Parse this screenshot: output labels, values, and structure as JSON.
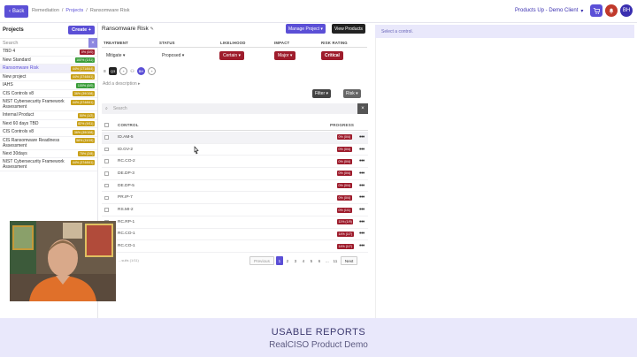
{
  "topbar": {
    "back_label": "Back",
    "crumbs": [
      "Remediation",
      "Projects",
      "Ransomware Risk"
    ],
    "client": "Products Up - Demo Client",
    "avatar": "BH"
  },
  "sidebar": {
    "title": "Projects",
    "create_label": "Create",
    "search_placeholder": "Search",
    "items": [
      {
        "name": "TBD 4",
        "badge": "0% (0/0)",
        "color": "#9e1c2c"
      },
      {
        "name": "New Standard",
        "badge": "100% (1/11)",
        "color": "#3a9d3a"
      },
      {
        "name": "Ransomware Risk",
        "badge": "44% (171/844)",
        "color": "#c9a11a"
      },
      {
        "name": "New project",
        "badge": "44% (374/841)",
        "color": "#c9a11a"
      },
      {
        "name": "IAHS",
        "badge": "100% (0/0)",
        "color": "#3a9d3a"
      },
      {
        "name": "CIS Controls v8",
        "badge": "36% (39/108)",
        "color": "#c9a11a"
      },
      {
        "name": "NIST Cybersecurity Framework Assessment",
        "badge": "44% (374/841)",
        "color": "#c9a11a"
      },
      {
        "name": "Internal Product",
        "badge": "50% (1/2)",
        "color": "#c9a11a"
      },
      {
        "name": "Next 60 days TBD",
        "badge": "82% (9/11)",
        "color": "#c9a11a"
      },
      {
        "name": "CIS Controls v8",
        "badge": "36% (39/108)",
        "color": "#c9a11a"
      },
      {
        "name": "CIS Ransomware Readiness Assessment",
        "badge": "58% (11/19)",
        "color": "#c9a11a"
      },
      {
        "name": "Next 30days",
        "badge": "75% (2/8)",
        "color": "#c9a11a"
      },
      {
        "name": "NIST Cybersecurity Framework Assessment",
        "badge": "44% (374/841)",
        "color": "#c9a11a"
      }
    ]
  },
  "risk": {
    "title": "Ransomware Risk",
    "manage_label": "Manage Project",
    "view_label": "View Products",
    "headers": {
      "treatment": "TREATMENT",
      "status": "STATUS",
      "likelihood": "LIKELIHOOD",
      "impact": "IMPACT",
      "risk_rating": "RISK RATING"
    },
    "treatment": "Mitigate",
    "status": "Proposed",
    "likelihood": "Certain",
    "impact": "Major",
    "risk_rating": "Critical",
    "tag1": "Q3",
    "tag2": "BH",
    "add_description": "Add a description"
  },
  "filters": {
    "filter_label": "Filter",
    "risk_label": "Risk"
  },
  "search": {
    "placeholder": "Search"
  },
  "table": {
    "col_control": "CONTROL",
    "col_progress": "PROGRESS",
    "rows": [
      {
        "control": "ID.AM-5",
        "progress": "0% (0/4)",
        "color": "#9e1c2c"
      },
      {
        "control": "ID.GV-2",
        "progress": "0% (0/4)",
        "color": "#9e1c2c"
      },
      {
        "control": "RC.CO-2",
        "progress": "0% (0/4)",
        "color": "#9e1c2c"
      },
      {
        "control": "DE.DP-3",
        "progress": "0% (0/4)",
        "color": "#9e1c2c"
      },
      {
        "control": "DE.DP-5",
        "progress": "0% (0/4)",
        "color": "#9e1c2c"
      },
      {
        "control": "PR.IP-7",
        "progress": "0% (0/4)",
        "color": "#9e1c2c"
      },
      {
        "control": "RS.MI-2",
        "progress": "0% (1/1)",
        "color": "#9e1c2c"
      },
      {
        "control": "RC.RP-1",
        "progress": "11% (1/9)",
        "color": "#9e1c2c"
      },
      {
        "control": "RC.CO-1",
        "progress": "14% (1/7)",
        "color": "#9e1c2c"
      },
      {
        "control": "RC.CO-1",
        "progress": "14% (1/7)",
        "color": "#9e1c2c"
      }
    ]
  },
  "pagination": {
    "prev": "Previous",
    "pages": [
      "1",
      "2",
      "3",
      "4",
      "5",
      "6",
      "...",
      "11"
    ],
    "next": "Next",
    "results": "...sults (1/11)"
  },
  "right_panel": {
    "message": "Select a control."
  },
  "banner": {
    "title": "USABLE REPORTS",
    "subtitle": "RealCISO Product Demo"
  }
}
